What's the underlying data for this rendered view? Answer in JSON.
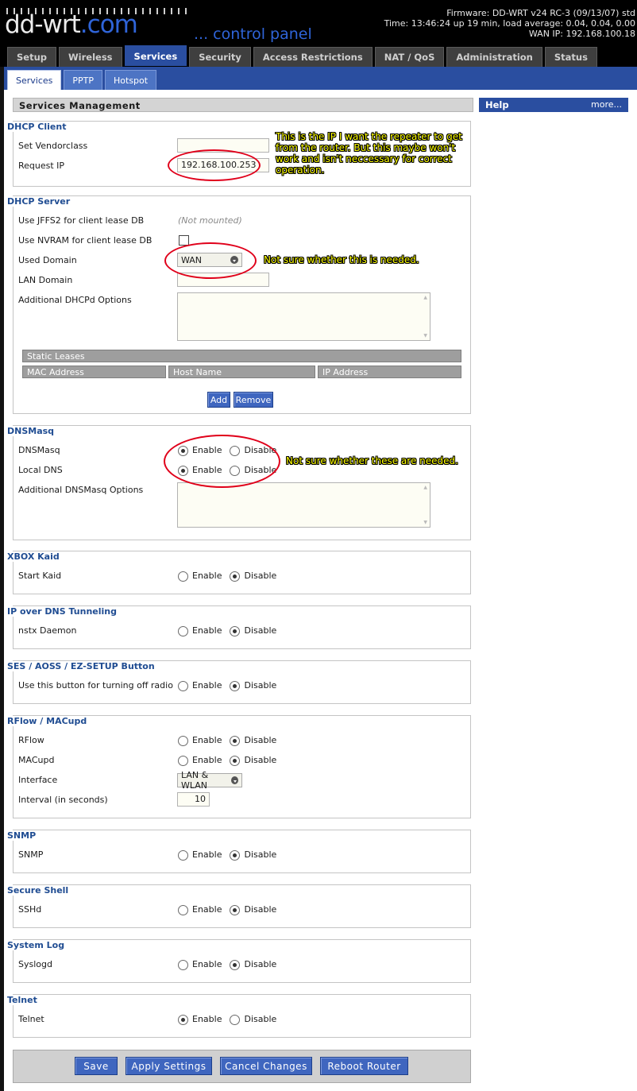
{
  "header": {
    "logo_main": "dd-wrt",
    "logo_suffix": ".com",
    "tagline": "... control panel",
    "firmware": "Firmware: DD-WRT v24 RC-3 (09/13/07) std",
    "time": "Time: 13:46:24 up 19 min, load average: 0.04, 0.04, 0.00",
    "wan_ip": "WAN IP: 192.168.100.18"
  },
  "main_tabs": [
    "Setup",
    "Wireless",
    "Services",
    "Security",
    "Access Restrictions",
    "NAT / QoS",
    "Administration",
    "Status"
  ],
  "sub_tabs": [
    "Services",
    "PPTP",
    "Hotspot"
  ],
  "page_header": "Services Management",
  "help": {
    "title": "Help",
    "more": "more..."
  },
  "radio_labels": {
    "enable": "Enable",
    "disable": "Disable"
  },
  "dhcp_client": {
    "title": "DHCP Client",
    "vendorclass_label": "Set Vendorclass",
    "vendorclass_value": "",
    "request_ip_label": "Request IP",
    "request_ip_value": "192.168.100.253"
  },
  "dhcp_server": {
    "title": "DHCP Server",
    "jffs2_label": "Use JFFS2 for client lease DB",
    "jffs2_value": "(Not mounted)",
    "nvram_label": "Use NVRAM for client lease DB",
    "used_domain_label": "Used Domain",
    "used_domain_value": "WAN",
    "lan_domain_label": "LAN Domain",
    "lan_domain_value": "",
    "dhcpd_options_label": "Additional DHCPd Options",
    "static_leases": "Static Leases",
    "columns": [
      "MAC Address",
      "Host Name",
      "IP Address"
    ],
    "add": "Add",
    "remove": "Remove"
  },
  "dnsmasq": {
    "title": "DNSMasq",
    "dnsmasq_label": "DNSMasq",
    "local_dns_label": "Local DNS",
    "options_label": "Additional DNSMasq Options"
  },
  "xbox": {
    "title": "XBOX Kaid",
    "label": "Start Kaid"
  },
  "ip_dns": {
    "title": "IP over DNS Tunneling",
    "label": "nstx Daemon"
  },
  "ses": {
    "title": "SES / AOSS / EZ-SETUP Button",
    "label": "Use this button for turning off radio"
  },
  "rflow": {
    "title": "RFlow / MACupd",
    "rflow_label": "RFlow",
    "macupd_label": "MACupd",
    "interface_label": "Interface",
    "interface_value": "LAN & WLAN",
    "interval_label": "Interval (in seconds)",
    "interval_value": "10"
  },
  "snmp": {
    "title": "SNMP",
    "label": "SNMP"
  },
  "ssh": {
    "title": "Secure Shell",
    "label": "SSHd"
  },
  "syslog": {
    "title": "System Log",
    "label": "Syslogd"
  },
  "telnet": {
    "title": "Telnet",
    "label": "Telnet"
  },
  "buttons": {
    "save": "Save",
    "apply": "Apply Settings",
    "cancel": "Cancel Changes",
    "reboot": "Reboot Router"
  },
  "annotations": {
    "ip_note_line1": "This is the IP I want the repeater to get",
    "ip_note_line2": "from the router. But this maybe won't",
    "ip_note_line3": "work and isn't neccessary for correct",
    "ip_note_line4": "operation.",
    "domain_note": "Not sure whether this is needed.",
    "dnsmasq_note": "Not sure whether these are needed."
  },
  "colors": {
    "accent": "#2a4ea0",
    "annotation_text": "#ffff00",
    "annotation_circle": "#e0001a"
  }
}
